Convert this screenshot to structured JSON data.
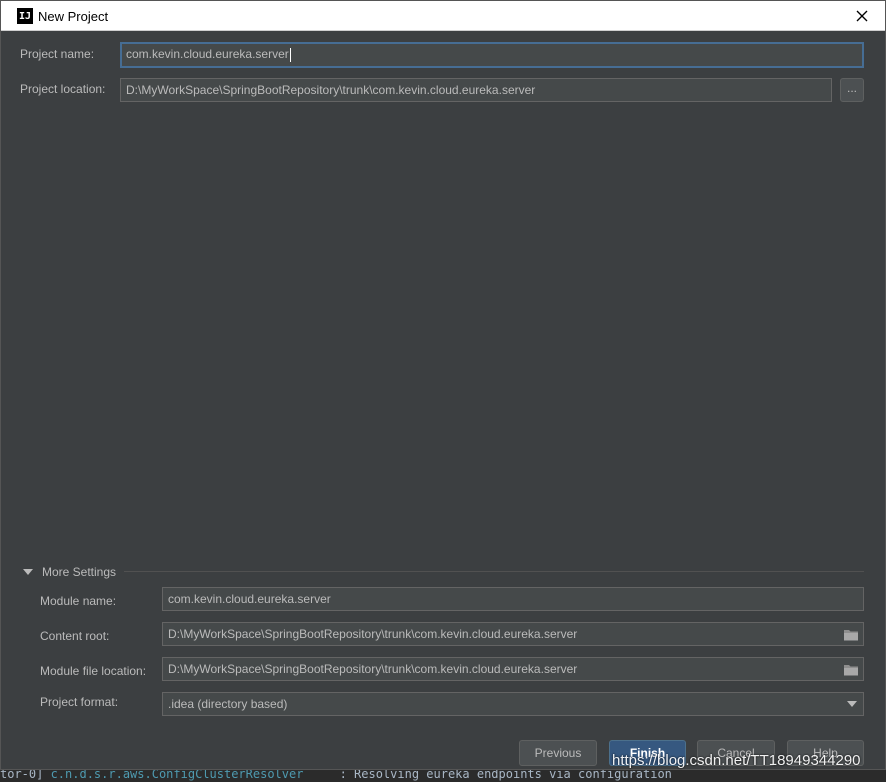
{
  "window": {
    "title": "New Project",
    "app_icon_text": "IJ"
  },
  "form": {
    "project_name": {
      "label": "Project name:",
      "value": "com.kevin.cloud.eureka.server"
    },
    "project_location": {
      "label": "Project location:",
      "value": "D:\\MyWorkSpace\\SpringBootRepository\\trunk\\com.kevin.cloud.eureka.server",
      "browse_label": "..."
    }
  },
  "more_settings": {
    "label": "More Settings",
    "module_name": {
      "label": "Module name:",
      "value": "com.kevin.cloud.eureka.server"
    },
    "content_root": {
      "label": "Content root:",
      "value": "D:\\MyWorkSpace\\SpringBootRepository\\trunk\\com.kevin.cloud.eureka.server"
    },
    "module_file_location": {
      "label": "Module file location:",
      "value": "D:\\MyWorkSpace\\SpringBootRepository\\trunk\\com.kevin.cloud.eureka.server"
    },
    "project_format": {
      "label": "Project format:",
      "value": ".idea (directory based)"
    }
  },
  "buttons": {
    "previous": "Previous",
    "finish": "Finish",
    "cancel": "Cancel",
    "help": "Help"
  },
  "background_console": {
    "prefix": "tor-0] ",
    "class_name": "c.n.d.s.r.aws.ConfigClusterResolver",
    "message": "     : Resolving eureka endpoints via configuration"
  },
  "watermark": "https://blog.csdn.net/TT18949344290",
  "colors": {
    "dialog_bg": "#3c3f41",
    "field_bg": "#45494a",
    "focus_border": "#466d94",
    "default_button": "#365880"
  }
}
